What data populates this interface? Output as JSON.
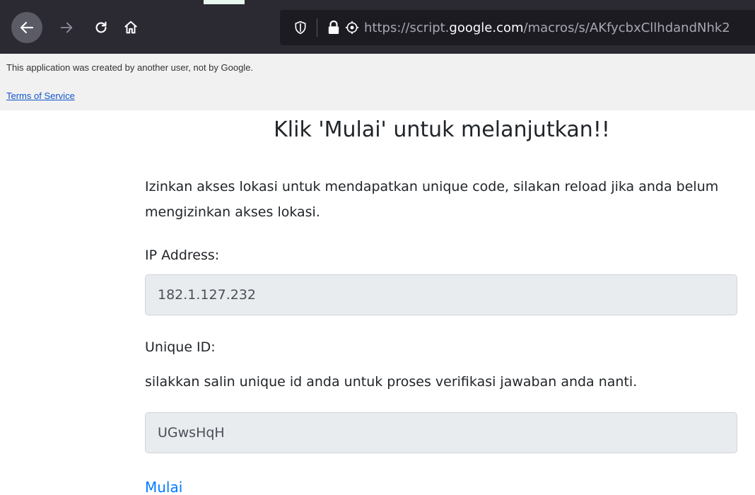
{
  "browser": {
    "url_scheme": "https://script.",
    "url_domain": "google.com",
    "url_path": "/macros/s/AKfycbxCllhdandNhk2"
  },
  "banner": {
    "note": "This application was created by another user, not by Google.",
    "terms_link": "Terms of Service"
  },
  "page": {
    "title": "Klik 'Mulai' untuk melanjutkan!!",
    "intro": "Izinkan akses lokasi untuk mendapatkan unique code, silakan reload jika anda belum mengizinkan akses lokasi.",
    "ip_label": "IP Address:",
    "ip_value": "182.1.127.232",
    "uid_label": "Unique ID:",
    "uid_help": "silakkan salin unique id anda untuk proses verifikasi jawaban anda nanti.",
    "uid_value": "UGwsHqH",
    "start_link": "Mulai"
  },
  "colors": {
    "toolbar": "#2b2a33",
    "link": "#007bff",
    "input_bg": "#e9ecef"
  }
}
